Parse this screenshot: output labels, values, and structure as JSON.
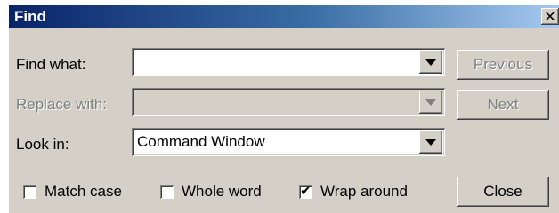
{
  "window": {
    "title": "Find",
    "close_glyph": "✕",
    "close_icon": "close-icon"
  },
  "find_what": {
    "label": "Find what:",
    "value": ""
  },
  "replace_with": {
    "label": "Replace with:",
    "value": "",
    "enabled": false
  },
  "look_in": {
    "label": "Look in:",
    "value": "Command Window"
  },
  "buttons": {
    "previous": "Previous",
    "next": "Next",
    "close": "Close"
  },
  "options": {
    "match_case": {
      "label": "Match case",
      "checked": false
    },
    "whole_word": {
      "label": "Whole word",
      "checked": false
    },
    "wrap_around": {
      "label": "Wrap around",
      "checked": true
    }
  },
  "check_glyph": "✔",
  "colors": {
    "face": "#d4d0c8",
    "title_start": "#0a246a",
    "title_end": "#a6caf0",
    "disabled_text": "#808080"
  }
}
